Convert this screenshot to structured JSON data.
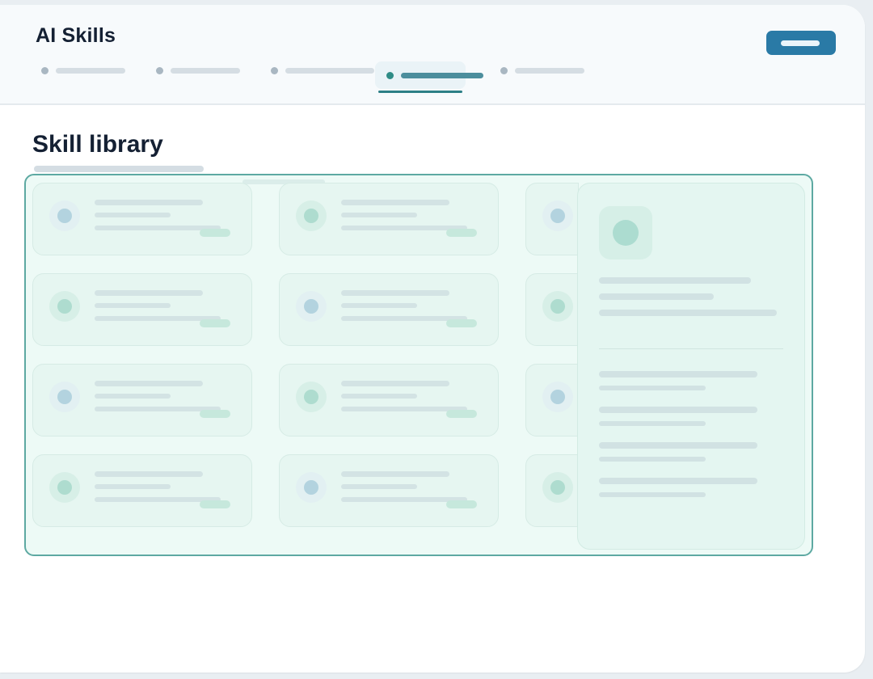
{
  "header": {
    "title": "AI Skills",
    "tabs_count_label": "",
    "active_tab_index": 3
  },
  "main": {
    "section_title": "Skill library"
  },
  "colors": {
    "accent": "#2a7aa6",
    "active_tab": "#2c7f86",
    "selection_border": "#5da9a2",
    "selection_fill": "#d7f3ec",
    "heading": "#142033"
  },
  "icons": {
    "primary_action": "button-placeholder",
    "skill_card": "dot-icon",
    "detail_avatar": "skill-avatar-icon"
  }
}
